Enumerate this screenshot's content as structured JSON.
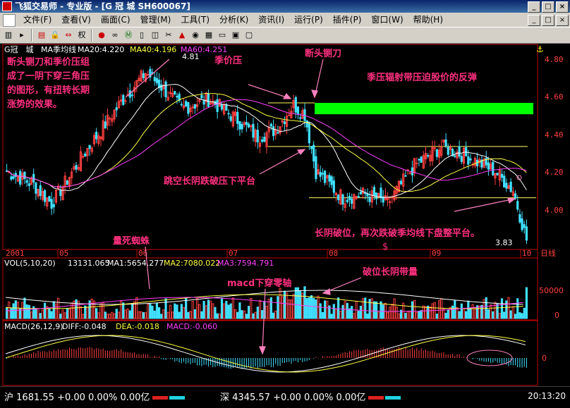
{
  "window": {
    "title": "飞狐交易师 - 专业版 - [G 冠 城 SH600067]",
    "buttons": [
      "_",
      "□",
      "×"
    ]
  },
  "menu": {
    "items": [
      "文件(F)",
      "查看(V)",
      "画面(C)",
      "管理(M)",
      "工具(T)",
      "分析(K)",
      "资讯(I)",
      "运行(P)",
      "插件(P)",
      "窗口(W)",
      "帮助(H)"
    ]
  },
  "toolbar": {
    "icons": [
      "chart-icon",
      "arrow-icon",
      "bars-icon",
      "lock-icon",
      "swap-icon",
      "weight-icon",
      "circles-icon",
      "glasses-icon",
      "m-icon",
      "book-icon",
      "box-icon",
      "tools-icon",
      "flame-icon",
      "bell-icon",
      "grid-icon",
      "page-icon",
      "f10-icon",
      "screen-icon"
    ],
    "weight_label": "权"
  },
  "main_legend": {
    "stock": "G冠　城",
    "indicator": "MA季均线",
    "ma20": "MA20:4.220",
    "ma40": "MA40:4.196",
    "ma60": "MA60:4.251"
  },
  "vol_legend": {
    "name": "VOL(5,10,20)",
    "value": "13131.065",
    "ma1": "MA1:5654.277",
    "ma2": "MA2:7080.022",
    "ma3": "MA3:7594.791"
  },
  "macd_legend": {
    "name": "MACD(26,12,9)",
    "diff": "DIFF:-0.048",
    "dea": "DEA:-0.018",
    "macd": "MACD:-0.060"
  },
  "annotations": {
    "a1": "断头铡刀和季价压组\n成了一阴下穿三角压\n的图形，有扭转长期\n涨势的效果。",
    "a2": "季价压",
    "a3": "断头铡刀",
    "a4": "季压辐射带压迫股价的反弹",
    "a5": "跳空长阴跌破压下平台",
    "a6": "长阴破位，再次跌破季均线下盘整平台。",
    "a7": "量死蜘蛛",
    "a8": "macd下穿零轴",
    "a9": "破位长阴带量",
    "high": "4.81",
    "low": "3.83",
    "dollar": "$"
  },
  "period_label": "日线",
  "status": {
    "sh_label": "沪",
    "sh": "1681.55 +0.00 0.00% 0.00亿",
    "sz_label": "深",
    "sz": "4345.57 +0.00 0.00% 0.00亿",
    "time": "20:13:20"
  },
  "colors": {
    "up": "#ff4040",
    "down": "#40e0ff",
    "ma20": "#ffffff",
    "ma40": "#ffff40",
    "ma60": "#ff40ff",
    "annotation": "#ff3080",
    "band": "#00ff00",
    "axis": "#c00000"
  },
  "chart_data": [
    {
      "type": "candlestick",
      "title": "G冠 城 MA季均线",
      "ylim": [
        3.83,
        4.81
      ],
      "y_ticks": [
        4.0,
        4.2,
        4.4,
        4.6,
        4.8
      ],
      "x_tick_labels": [
        "2001",
        "05",
        "06",
        "07",
        "08",
        "09",
        "10"
      ],
      "series": [
        {
          "name": "MA20",
          "last": 4.22
        },
        {
          "name": "MA40",
          "last": 4.196
        },
        {
          "name": "MA60",
          "last": 4.251
        }
      ],
      "annotated_high": 4.81,
      "annotated_low": 3.83,
      "levels": [
        4.35,
        4.08
      ],
      "resistance_band": [
        4.52,
        4.58
      ]
    },
    {
      "type": "bar",
      "title": "VOL(5,10,20)",
      "last_volume": 13131.065,
      "y_ticks": [
        0,
        50000
      ],
      "series": [
        {
          "name": "MA1",
          "last": 5654.277
        },
        {
          "name": "MA2",
          "last": 7080.022
        },
        {
          "name": "MA3",
          "last": 7594.791
        }
      ]
    },
    {
      "type": "bar",
      "title": "MACD(26,12,9)",
      "y_ticks": [
        0.0
      ],
      "series": [
        {
          "name": "DIFF",
          "last": -0.048
        },
        {
          "name": "DEA",
          "last": -0.018
        },
        {
          "name": "MACD",
          "last": -0.06
        }
      ]
    }
  ]
}
